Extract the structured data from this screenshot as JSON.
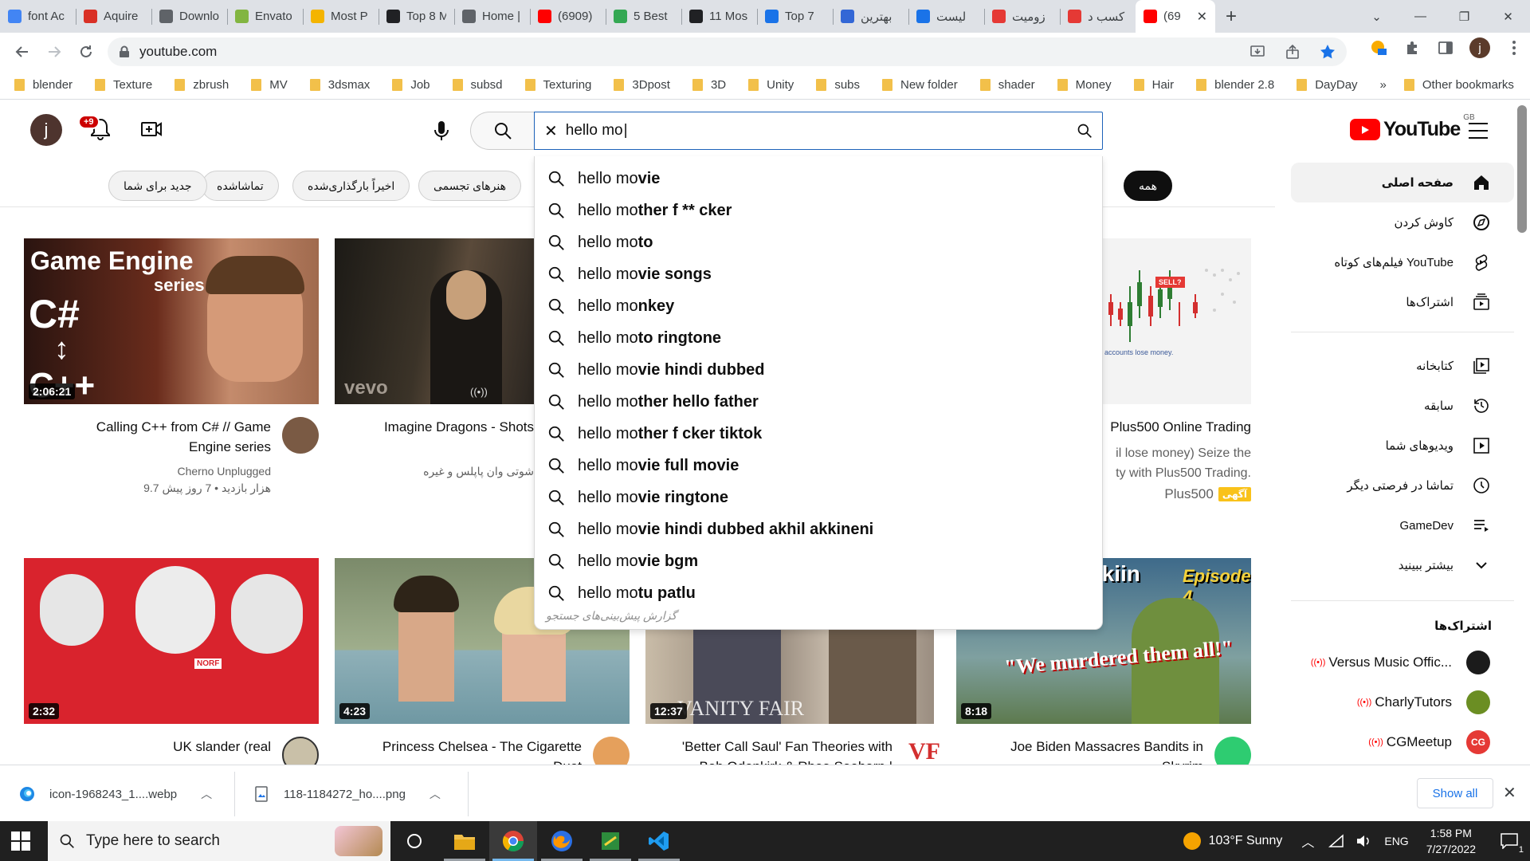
{
  "browser": {
    "tabs": [
      {
        "title": "font Ac",
        "icon": "google-icon",
        "color": "#4285f4"
      },
      {
        "title": "Aquire",
        "icon": "b-icon",
        "color": "#d93025"
      },
      {
        "title": "Downlo",
        "icon": "globe-icon",
        "color": "#5f6368"
      },
      {
        "title": "Envato",
        "icon": "envato-icon",
        "color": "#82b541"
      },
      {
        "title": "Most P",
        "icon": "bookmark-icon",
        "color": "#f4b400"
      },
      {
        "title": "Top 8 M",
        "icon": "square-icon",
        "color": "#202124"
      },
      {
        "title": "Home |",
        "icon": "globe-icon",
        "color": "#5f6368"
      },
      {
        "title": "(6909)",
        "icon": "youtube-icon",
        "color": "#ff0000"
      },
      {
        "title": "5 Best",
        "icon": "dots-icon",
        "color": "#34a853"
      },
      {
        "title": "11 Mos",
        "icon": "pen-icon",
        "color": "#202124"
      },
      {
        "title": "Top 7",
        "icon": "itpro-icon",
        "color": "#1a73e8"
      },
      {
        "title": "بهترین",
        "icon": "site-icon",
        "color": "#3367d6"
      },
      {
        "title": "لیست",
        "icon": "site-icon",
        "color": "#1a73e8"
      },
      {
        "title": "زومیت",
        "icon": "zoomit-icon",
        "color": "#e53935"
      },
      {
        "title": "کسب د",
        "icon": "zoomit-icon",
        "color": "#e53935"
      },
      {
        "title": "(69",
        "icon": "youtube-icon",
        "color": "#ff0000",
        "active": true
      }
    ],
    "new_tab": "+",
    "window_controls": {
      "minimize": "—",
      "restore": "❐",
      "close": "✕",
      "tab_search": "⌄"
    },
    "url": "youtube.com",
    "bookmarks": [
      "blender",
      "Texture",
      "zbrush",
      "MV",
      "3dsmax",
      "Job",
      "subsd",
      "Texturing",
      "3Dpost",
      "3D",
      "Unity",
      "subs",
      "New folder",
      "shader",
      "Money",
      "Hair",
      "blender 2.8",
      "DayDay"
    ],
    "bookmarks_more": "»",
    "other_bookmarks": "Other bookmarks",
    "profile_initial": "j"
  },
  "youtube": {
    "avatar_initial": "j",
    "notification_count": "+9",
    "search_query": "hello mo",
    "logo_text": "YouTube",
    "logo_region": "GB",
    "chips": [
      {
        "label": "همه",
        "active": true
      },
      {
        "label": "هنرهای تجسمی"
      },
      {
        "label": "اخیراً بارگذاری‌شده"
      },
      {
        "label": "تماشاشده"
      },
      {
        "label": "جدید برای شما"
      }
    ],
    "suggestions": [
      {
        "prefix": "hello mo",
        "rest": "vie"
      },
      {
        "prefix": "hello mo",
        "rest": "ther f ** cker"
      },
      {
        "prefix": "hello mo",
        "rest": "to"
      },
      {
        "prefix": "hello mo",
        "rest": "vie songs"
      },
      {
        "prefix": "hello mo",
        "rest": "nkey"
      },
      {
        "prefix": "hello mo",
        "rest": "to ringtone"
      },
      {
        "prefix": "hello mo",
        "rest": "vie hindi dubbed"
      },
      {
        "prefix": "hello mo",
        "rest": "ther hello father"
      },
      {
        "prefix": "hello mo",
        "rest": "ther f cker tiktok"
      },
      {
        "prefix": "hello mo",
        "rest": "vie full movie"
      },
      {
        "prefix": "hello mo",
        "rest": "vie ringtone"
      },
      {
        "prefix": "hello mo",
        "rest": "vie hindi dubbed akhil akkineni"
      },
      {
        "prefix": "hello mo",
        "rest": "vie bgm"
      },
      {
        "prefix": "hello mo",
        "rest": "tu patlu"
      }
    ],
    "report_predictions": "گزارش پیش‌بینی‌های جستجو",
    "videos_row1": [
      {
        "title_line1": "Calling C++ from C# // Game",
        "title_line2": "Engine series",
        "channel": "Cherno Unplugged",
        "stats": "9.7 هزار بازدید • 7 روز پیش",
        "duration": "2:06:21",
        "thumb_text1": "Game Engine",
        "thumb_text2": "series",
        "thumb_text3": "C#",
        "thumb_text4": "C++"
      },
      {
        "title_line1": "Imagine Dragons - Shots",
        "stats": "شوتی وان پاپلس و غیره",
        "thumb_text": "vevo",
        "live_icon": "((•))"
      },
      {
        "title_line1": "Plus500 Online Trading",
        "desc_line1": "il lose money) Seize the",
        "desc_line2": "ty with Plus500 Trading.",
        "channel": "Plus500",
        "ad_badge": "آگهی",
        "sell_label": "SELL?",
        "risk_text": "accounts lose money."
      }
    ],
    "videos_row2": [
      {
        "title": "UK slander (real",
        "duration": "2:32",
        "thumb_text": "NORF"
      },
      {
        "title_line1": "Princess Chelsea - The Cigarette",
        "title_line2": "Duet",
        "duration": "4:23"
      },
      {
        "title_line1": "'Better Call Saul' Fan Theories with",
        "title_line2": "Bob Odenkirk & Rhea Seehorn |",
        "duration": "12:37",
        "thumb_text": "VANITY FAIR",
        "channel_logo": "VF"
      },
      {
        "title_line1": "Joe Biden Massacres Bandits in",
        "title_line2": "Skyrim",
        "duration": "8:18",
        "thumb_text1": "ahkiin",
        "thumb_text2": "Episode 4",
        "thumb_text3": "\"We murdered them all!\""
      }
    ],
    "sidebar": {
      "items": [
        {
          "label": "صفحه اصلی",
          "icon": "home-icon",
          "active": true
        },
        {
          "label": "کاوش کردن",
          "icon": "explore-icon"
        },
        {
          "label": "فیلم‌های کوتاه YouTube",
          "icon": "shorts-icon"
        },
        {
          "label": "اشتراک‌ها",
          "icon": "subscriptions-icon"
        },
        {
          "label": "کتابخانه",
          "icon": "library-icon"
        },
        {
          "label": "سابقه",
          "icon": "history-icon"
        },
        {
          "label": "ویدیوهای شما",
          "icon": "your-videos-icon"
        },
        {
          "label": "تماشا در فرصتی دیگر",
          "icon": "watch-later-icon"
        },
        {
          "label": "GameDev",
          "icon": "playlist-icon"
        },
        {
          "label": "بیشتر ببینید",
          "icon": "chevron-down-icon"
        }
      ],
      "subscriptions_heading": "اشتراک‌ها",
      "subscriptions": [
        {
          "name": "Versus Music Offic...",
          "live": "((•))",
          "color": "#1b1b1b"
        },
        {
          "name": "CharlyTutors",
          "live": "((•))",
          "color": "#6b8e23"
        },
        {
          "name": "CGMeetup",
          "live": "((•))",
          "color": "#e53935",
          "initials": "CG"
        }
      ]
    }
  },
  "downloads": {
    "items": [
      {
        "name": "icon-1968243_1....webp",
        "icon": "edge-icon"
      },
      {
        "name": "118-1184272_ho....png",
        "icon": "image-file-icon"
      }
    ],
    "show_all": "Show all",
    "close": "✕"
  },
  "taskbar": {
    "search_placeholder": "Type here to search",
    "weather": "103°F  Sunny",
    "language": "ENG",
    "time": "1:58 PM",
    "date": "7/27/2022",
    "notifications": "1"
  }
}
